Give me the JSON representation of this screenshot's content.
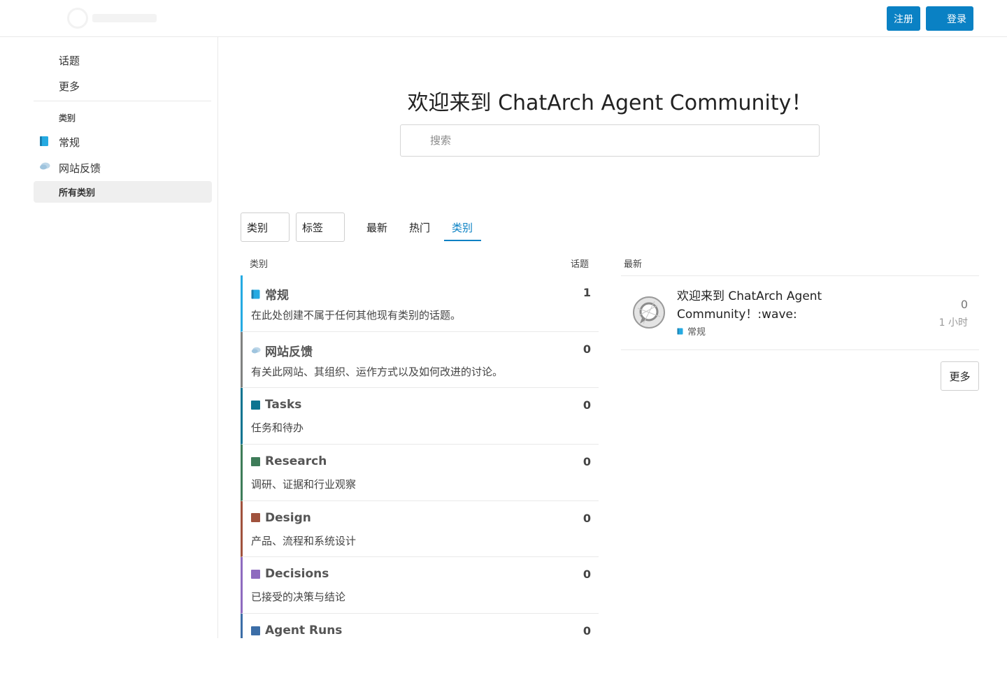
{
  "header": {
    "signup_label": "注册",
    "login_label": "登录"
  },
  "sidebar": {
    "links": [
      "话题",
      "更多"
    ],
    "section_title": "类别",
    "categories": [
      {
        "label": "常规",
        "icon": "book-icon"
      },
      {
        "label": "网站反馈",
        "icon": "speech-bubble-icon"
      }
    ],
    "all_categories_label": "所有类别"
  },
  "main": {
    "welcome": "欢迎来到 ChatArch Agent Community！",
    "search_placeholder": "搜索",
    "filters": {
      "category_select": "类别",
      "tag_select": "标签"
    },
    "tabs": [
      {
        "label": "最新",
        "active": false
      },
      {
        "label": "热门",
        "active": false
      },
      {
        "label": "类别",
        "active": true
      }
    ],
    "columns": {
      "category": "类别",
      "topics": "话题",
      "latest": "最新"
    },
    "categories": [
      {
        "name": "常规",
        "desc": "在此处创建不属于任何其他现有类别的话题。",
        "count": "1",
        "color": "#25aae2",
        "icon": "book-icon"
      },
      {
        "name": "网站反馈",
        "desc": "有关此网站、其组织、运作方式以及如何改进的讨论。",
        "count": "0",
        "color": "#808281",
        "icon": "speech-bubble-icon"
      },
      {
        "name": "Tasks",
        "desc": "任务和待办",
        "count": "0",
        "color": "#0e7490",
        "icon": "square"
      },
      {
        "name": "Research",
        "desc": "调研、证据和行业观察",
        "count": "0",
        "color": "#3e7c59",
        "icon": "square"
      },
      {
        "name": "Design",
        "desc": "产品、流程和系统设计",
        "count": "0",
        "color": "#a0523d",
        "icon": "square"
      },
      {
        "name": "Decisions",
        "desc": "已接受的决策与结论",
        "count": "0",
        "color": "#8e6bbf",
        "icon": "square"
      },
      {
        "name": "Agent Runs",
        "desc": "",
        "count": "0",
        "color": "#3c6ea7",
        "icon": "square"
      }
    ],
    "latest_topics": [
      {
        "title": "欢迎来到 ChatArch Agent Community！:wave:",
        "category": "常规",
        "replies": "0",
        "age": "1 小时"
      }
    ],
    "more_label": "更多"
  },
  "colors": {
    "accent": "#0a81c4"
  }
}
